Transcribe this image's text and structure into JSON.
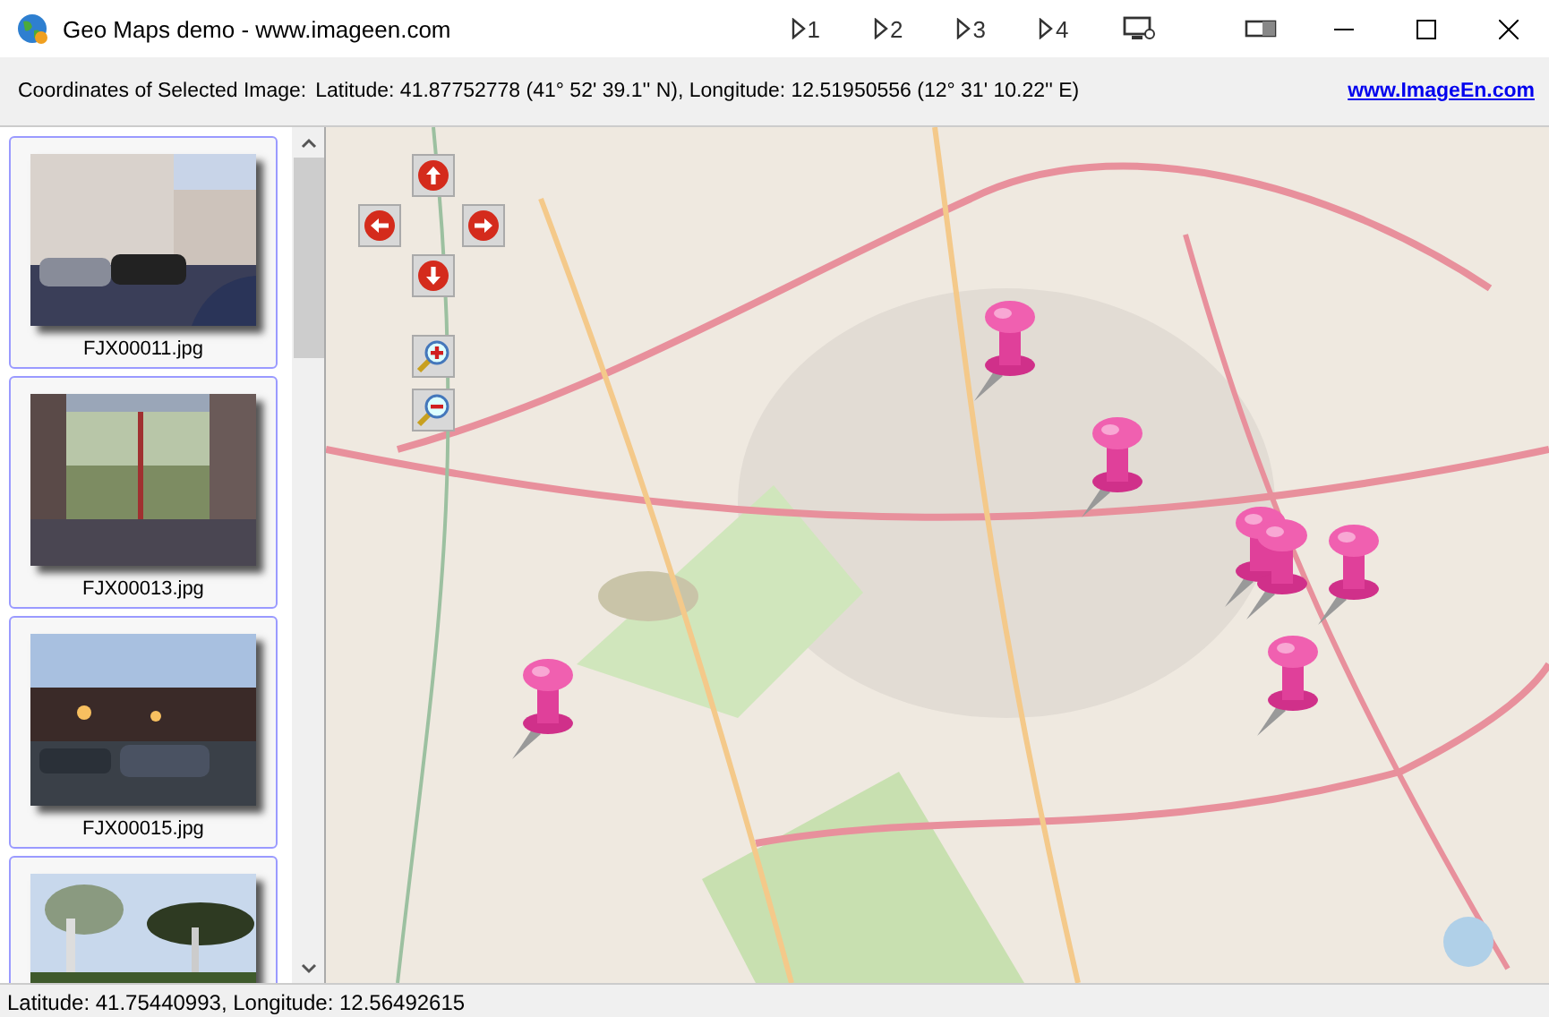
{
  "window": {
    "title": "Geo Maps demo - www.imageen.com"
  },
  "toolbar": [
    {
      "label": "1"
    },
    {
      "label": "2"
    },
    {
      "label": "3"
    },
    {
      "label": "4"
    }
  ],
  "info_bar": {
    "label": "Coordinates of Selected Image:",
    "value": "Latitude: 41.87752778 (41° 52' 39.1'' N), Longitude: 12.51950556 (12° 31' 10.22'' E)",
    "link": "www.ImageEn.com"
  },
  "thumbnails": [
    {
      "caption": "FJX00011.jpg",
      "kind": "street"
    },
    {
      "caption": "FJX00013.jpg",
      "kind": "glass"
    },
    {
      "caption": "FJX00015.jpg",
      "kind": "dusk"
    },
    {
      "kind": "trees"
    }
  ],
  "status_bar": "Latitude: 41.75440993, Longitude: 12.56492615"
}
